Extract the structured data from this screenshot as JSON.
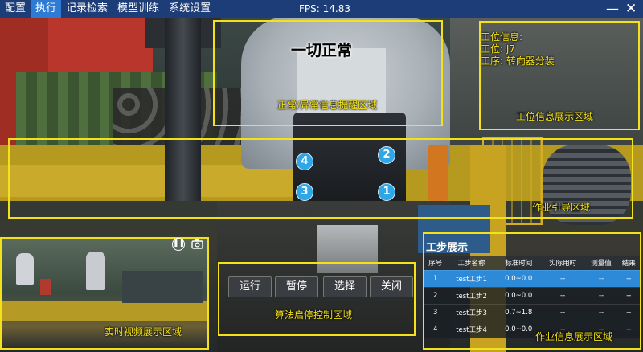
{
  "menu": {
    "items": [
      {
        "label": "配置"
      },
      {
        "label": "执行",
        "active": true
      },
      {
        "label": "记录检索"
      },
      {
        "label": "模型训练"
      },
      {
        "label": "系统设置"
      }
    ]
  },
  "status": {
    "fps": "FPS: 14.83"
  },
  "window": {
    "minimize": "—",
    "close": "✕"
  },
  "alert": {
    "message": "一切正常",
    "zone_label": "正常/异常信息提醒区域"
  },
  "station": {
    "heading": "工位信息:",
    "station": "工位: J7",
    "process": "工序: 转向器分装",
    "zone_label": "工位信息展示区域"
  },
  "guide": {
    "zone_label": "作业引导区域"
  },
  "markers": [
    "1",
    "2",
    "3",
    "4"
  ],
  "video": {
    "zone_label": "实时视频展示区域",
    "pause_icon": "pause-icon",
    "camera_icon": "camera-icon"
  },
  "controls": {
    "run": "运行",
    "pause": "暂停",
    "select": "选择",
    "close": "关闭",
    "zone_label": "算法启停控制区域"
  },
  "steps": {
    "title": "工步展示",
    "zone_label": "作业信息展示区域",
    "columns": [
      "序号",
      "工步名称",
      "标准时间",
      "实际用时",
      "测量值",
      "结果"
    ],
    "rows": [
      [
        "1",
        "test工步1",
        "0.0~0.0",
        "--",
        "--",
        "--"
      ],
      [
        "2",
        "test工步2",
        "0.0~0.0",
        "--",
        "--",
        "--"
      ],
      [
        "3",
        "test工步3",
        "0.7~1.8",
        "--",
        "--",
        "--"
      ],
      [
        "4",
        "test工步4",
        "0.0~0.0",
        "--",
        "--",
        "--"
      ]
    ],
    "selected_row": 0
  },
  "colors": {
    "menu_bg": "#1d3d78",
    "menu_active": "#2d7bd4",
    "zone": "#f3e21a",
    "marker": "#2fa6e6",
    "row_selected": "#2c8ad8"
  }
}
